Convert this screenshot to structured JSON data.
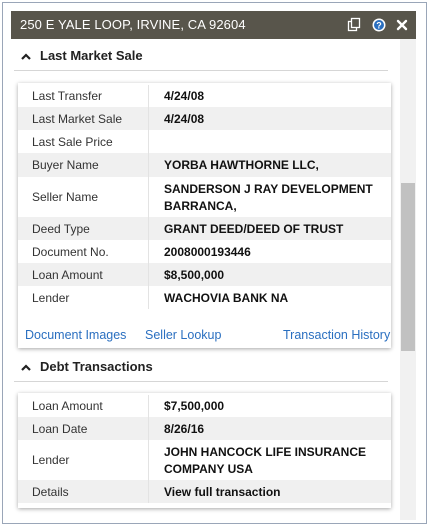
{
  "window": {
    "title": "250 E YALE LOOP, IRVINE, CA 92604"
  },
  "last_market_sale": {
    "header": "Last Market Sale",
    "rows": [
      {
        "label": "Last Transfer",
        "value": "4/24/08"
      },
      {
        "label": "Last Market Sale",
        "value": "4/24/08"
      },
      {
        "label": "Last Sale Price",
        "value": ""
      },
      {
        "label": "Buyer Name",
        "value": "YORBA HAWTHORNE LLC,"
      },
      {
        "label": "Seller Name",
        "value": "SANDERSON J RAY DEVELOPMENT BARRANCA,"
      },
      {
        "label": "Deed Type",
        "value": "GRANT DEED/DEED OF TRUST"
      },
      {
        "label": "Document No.",
        "value": "2008000193446"
      },
      {
        "label": "Loan Amount",
        "value": "$8,500,000"
      },
      {
        "label": "Lender",
        "value": "WACHOVIA BANK NA"
      }
    ],
    "links": {
      "document_images": "Document Images",
      "seller_lookup": "Seller Lookup",
      "transaction_history": "Transaction History"
    }
  },
  "debt_transactions": {
    "header": "Debt Transactions",
    "rows": [
      {
        "label": "Loan Amount",
        "value": "$7,500,000"
      },
      {
        "label": "Loan Date",
        "value": "8/26/16"
      },
      {
        "label": "Lender",
        "value": "JOHN HANCOCK LIFE INSURANCE COMPANY USA"
      },
      {
        "label": "Details",
        "value": "View full transaction"
      }
    ]
  },
  "colors": {
    "titlebar": "#58554b",
    "link": "#2a6fc0",
    "alt_row": "#f0f0f0"
  },
  "icons": [
    "copy-icon",
    "help-icon",
    "close-icon",
    "chevron-up-icon"
  ]
}
